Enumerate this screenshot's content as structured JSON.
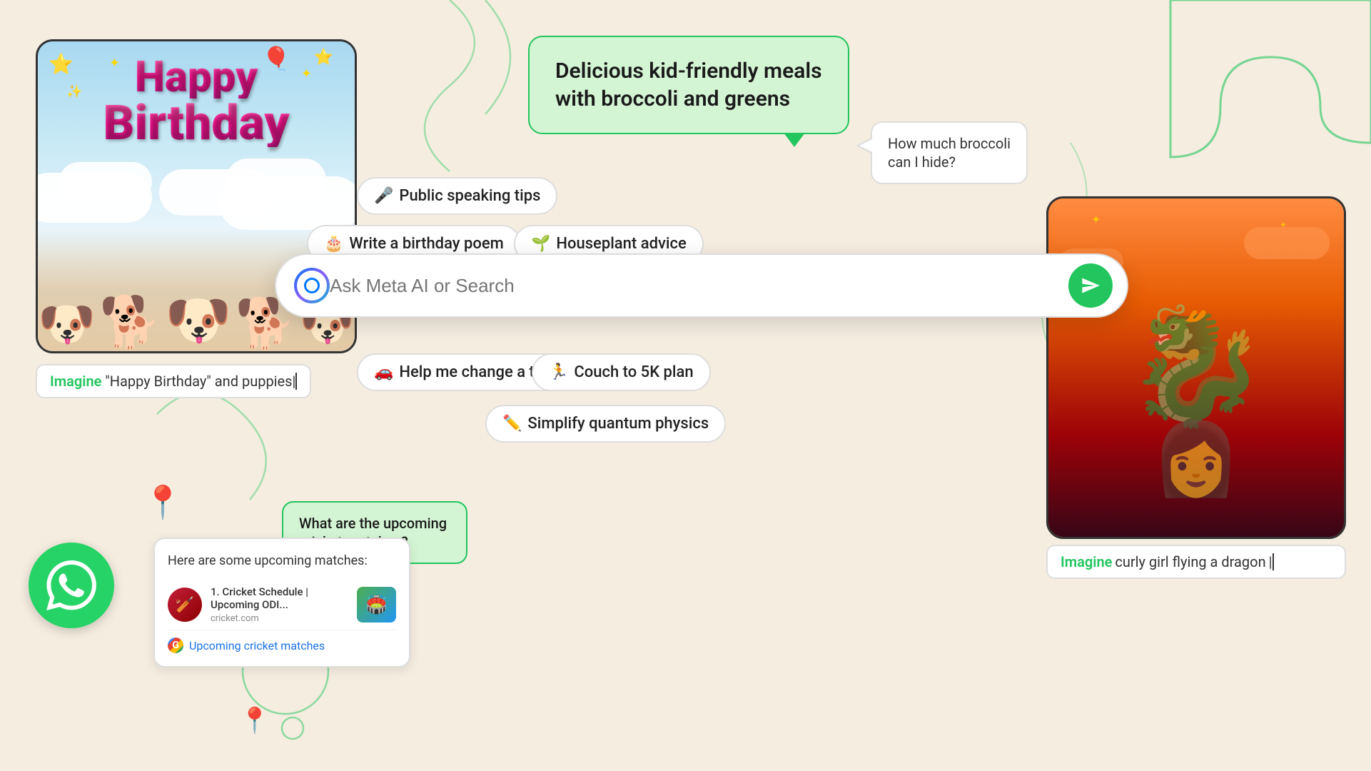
{
  "app": {
    "title": "Meta AI",
    "background_color": "#f5ede0",
    "accent_green": "#22c55e"
  },
  "search": {
    "placeholder": "Ask Meta AI or Search",
    "send_label": "Send"
  },
  "pills": [
    {
      "id": "public-speaking",
      "icon": "🎤",
      "label": "Public speaking tips"
    },
    {
      "id": "birthday-poem",
      "icon": "🎂",
      "label": "Write a birthday poem"
    },
    {
      "id": "houseplant",
      "icon": "🌱",
      "label": "Houseplant advice"
    },
    {
      "id": "change-tire",
      "icon": "🚗",
      "label": "Help me change a tire"
    },
    {
      "id": "couch-to-5k",
      "icon": "🏃",
      "label": "Couch to 5K plan"
    },
    {
      "id": "quantum",
      "icon": "✏️",
      "label": "Simplify quantum physics"
    }
  ],
  "speech_bubbles": [
    {
      "id": "kid-meals",
      "text": "Delicious kid-friendly meals\nwith broccoli and greens",
      "type": "green"
    },
    {
      "id": "broccoli",
      "text": "How much broccoli can I hide?",
      "type": "white"
    }
  ],
  "birthday_card": {
    "line1": "Happy",
    "line2": "Birthday"
  },
  "birthday_caption": {
    "imagine": "Imagine",
    "text": " \"Happy Birthday\" and puppies"
  },
  "dragon_caption": {
    "imagine": "Imagine",
    "text": " curly girl flying a dragon"
  },
  "cricket_card": {
    "intro_text": "Here are some upcoming matches:",
    "result_title": "Cricket Schedule | Upcoming ODI...",
    "result_domain": "cricket.com",
    "google_link": "Upcoming cricket matches"
  },
  "cricket_query": {
    "text": "What are the upcoming cricket matches?"
  }
}
